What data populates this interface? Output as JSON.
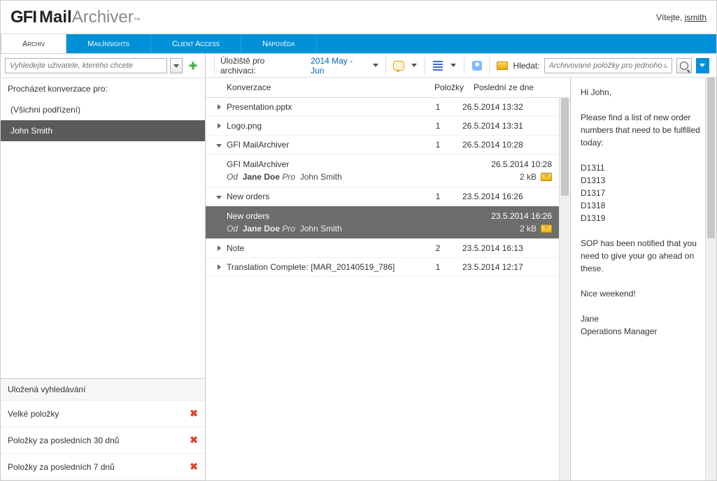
{
  "header": {
    "welcome_prefix": "Vítejte,",
    "username": "jsmith"
  },
  "tabs": [
    "Archiv",
    "MailInsights",
    "Client Access",
    "Nápověda"
  ],
  "sidebar": {
    "search_placeholder": "Vyhledejte uživatele, kterého chcete",
    "browse_label": "Procházet konverzace pro:",
    "tree": [
      {
        "label": "(Všichni podřízení)",
        "selected": false
      },
      {
        "label": "John Smith",
        "selected": true
      }
    ],
    "saved_title": "Uložená vyhledávání",
    "saved": [
      "Velké položky",
      "Položky za posledních 30 dnů",
      "Položky za posledních 7 dnů"
    ]
  },
  "toolbar": {
    "store_label": "Úložiště pro archivaci:",
    "store_value": "2014 May - Jun",
    "search_label": "Hledat:",
    "search_placeholder": "Archivované položky pro jednoho už"
  },
  "columns": {
    "conversation": "Konverzace",
    "items": "Položky",
    "date": "Poslední ze dne"
  },
  "conversations": [
    {
      "expand": "right",
      "title": "Presentation.pptx",
      "items": "1",
      "date": "26.5.2014 13:32"
    },
    {
      "expand": "right",
      "title": "Logo.png",
      "items": "1",
      "date": "26.5.2014 13:31"
    },
    {
      "expand": "down",
      "title": "GFI MailArchiver",
      "items": "1",
      "date": "26.5.2014 10:28",
      "message": {
        "title": "GFI MailArchiver",
        "date": "26.5.2014 10:28",
        "from_label": "Od",
        "from": "Jane Doe",
        "to_label": "Pro",
        "to": "John Smith",
        "size": "2 kB",
        "selected": false
      }
    },
    {
      "expand": "down",
      "title": "New orders",
      "items": "1",
      "date": "23.5.2014 16:26",
      "message": {
        "title": "New orders",
        "date": "23.5.2014 16:26",
        "from_label": "Od",
        "from": "Jane Doe",
        "to_label": "Pro",
        "to": "John Smith",
        "size": "2 kB",
        "selected": true
      }
    },
    {
      "expand": "right",
      "title": "Note",
      "items": "2",
      "date": "23.5.2014 16:13"
    },
    {
      "expand": "right",
      "title": "Translation Complete: [MAR_20140519_786]",
      "items": "1",
      "date": "23.5.2014 12:17"
    }
  ],
  "preview": {
    "greeting": "Hi John,",
    "intro": "Please find a list of new order numbers that need to be fulfilled today:",
    "orders": [
      "D1311",
      "D1313",
      "D1317",
      "D1318",
      "D1319"
    ],
    "note": "SOP has been notified that you need to give your go ahead on these.",
    "closing": "Nice weekend!",
    "sig_name": "Jane",
    "sig_title": "Operations Manager"
  }
}
